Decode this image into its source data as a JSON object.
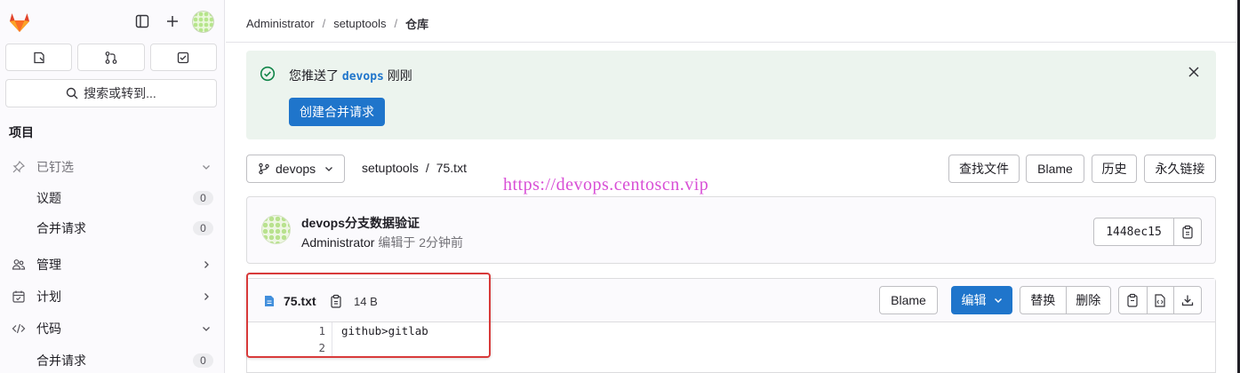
{
  "sidebar": {
    "search_label": "搜索或转到...",
    "section_title": "项目",
    "items": [
      {
        "label": "已钉选",
        "type": "group"
      },
      {
        "label": "议题",
        "badge": "0"
      },
      {
        "label": "合并请求",
        "badge": "0"
      },
      {
        "label": "管理",
        "type": "group"
      },
      {
        "label": "计划",
        "type": "group"
      },
      {
        "label": "代码",
        "type": "group"
      },
      {
        "label": "合并请求",
        "badge": "0"
      }
    ]
  },
  "breadcrumb": [
    "Administrator",
    "setuptools",
    "仓库"
  ],
  "alert": {
    "prefix": "您推送了 ",
    "branch": "devops",
    "suffix": " 刚刚",
    "action_label": "创建合并请求"
  },
  "repo": {
    "branch": "devops",
    "path_project": "setuptools",
    "path_sep": "/",
    "path_file": "75.txt",
    "actions": [
      "查找文件",
      "Blame",
      "历史",
      "永久链接"
    ]
  },
  "watermark": "https://devops.centoscn.vip",
  "commit": {
    "title": "devops分支数据验证",
    "author": "Administrator",
    "meta": " 编辑于 2分钟前",
    "sha": "1448ec15"
  },
  "file": {
    "name": "75.txt",
    "size": "14 B",
    "blame_label": "Blame",
    "edit_label": "编辑",
    "replace_label": "替换",
    "delete_label": "删除",
    "lines": [
      {
        "num": "1",
        "text": "github>gitlab"
      },
      {
        "num": "2",
        "text": ""
      }
    ]
  },
  "colors": {
    "primary": "#1f75cb",
    "alert_bg": "#ecf4ee",
    "success": "#108548",
    "highlight_border": "#d83a3a",
    "watermark": "#d84fd6"
  }
}
